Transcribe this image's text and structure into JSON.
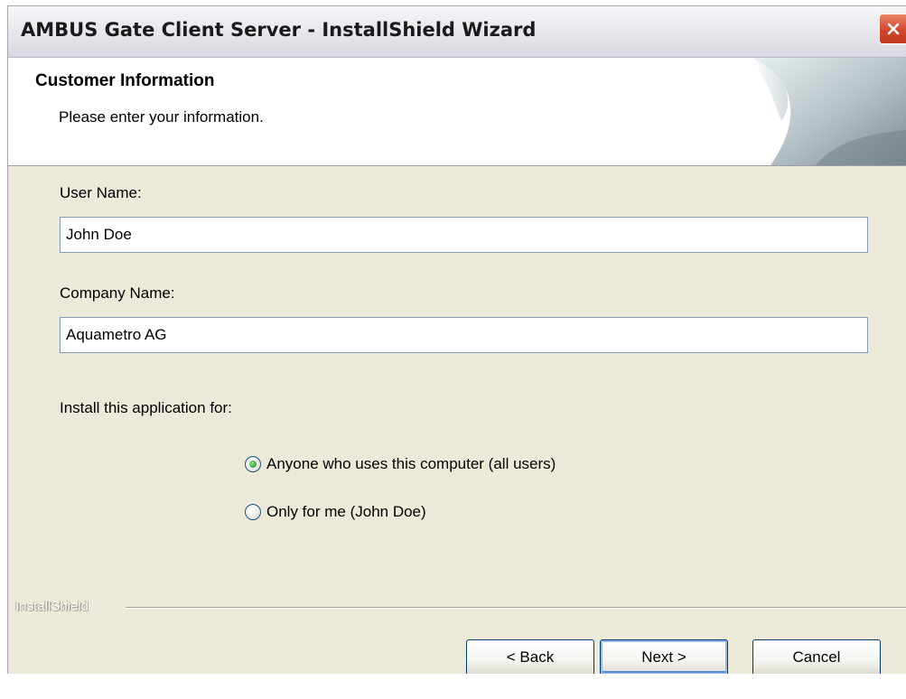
{
  "window": {
    "title": "AMBUS Gate Client Server - InstallShield Wizard"
  },
  "header": {
    "title": "Customer Information",
    "subtitle": "Please enter your information."
  },
  "form": {
    "user_name_label": "User Name:",
    "user_name_value": "John Doe",
    "company_name_label": "Company Name:",
    "company_name_value": "Aquametro AG",
    "install_for_label": "Install this application for:",
    "options": [
      {
        "label": "Anyone who uses this computer (all users)",
        "selected": true
      },
      {
        "label": "Only for me (John Doe)",
        "selected": false
      }
    ]
  },
  "footer": {
    "brand": "InstallShield",
    "back_label": "< Back",
    "next_label": "Next >",
    "cancel_label": "Cancel"
  },
  "icons": {
    "close": "close-icon"
  },
  "colors": {
    "close_button": "#d2462a",
    "dialog_background": "#ece9d8",
    "input_border": "#7f9db9",
    "button_border": "#003c74"
  }
}
